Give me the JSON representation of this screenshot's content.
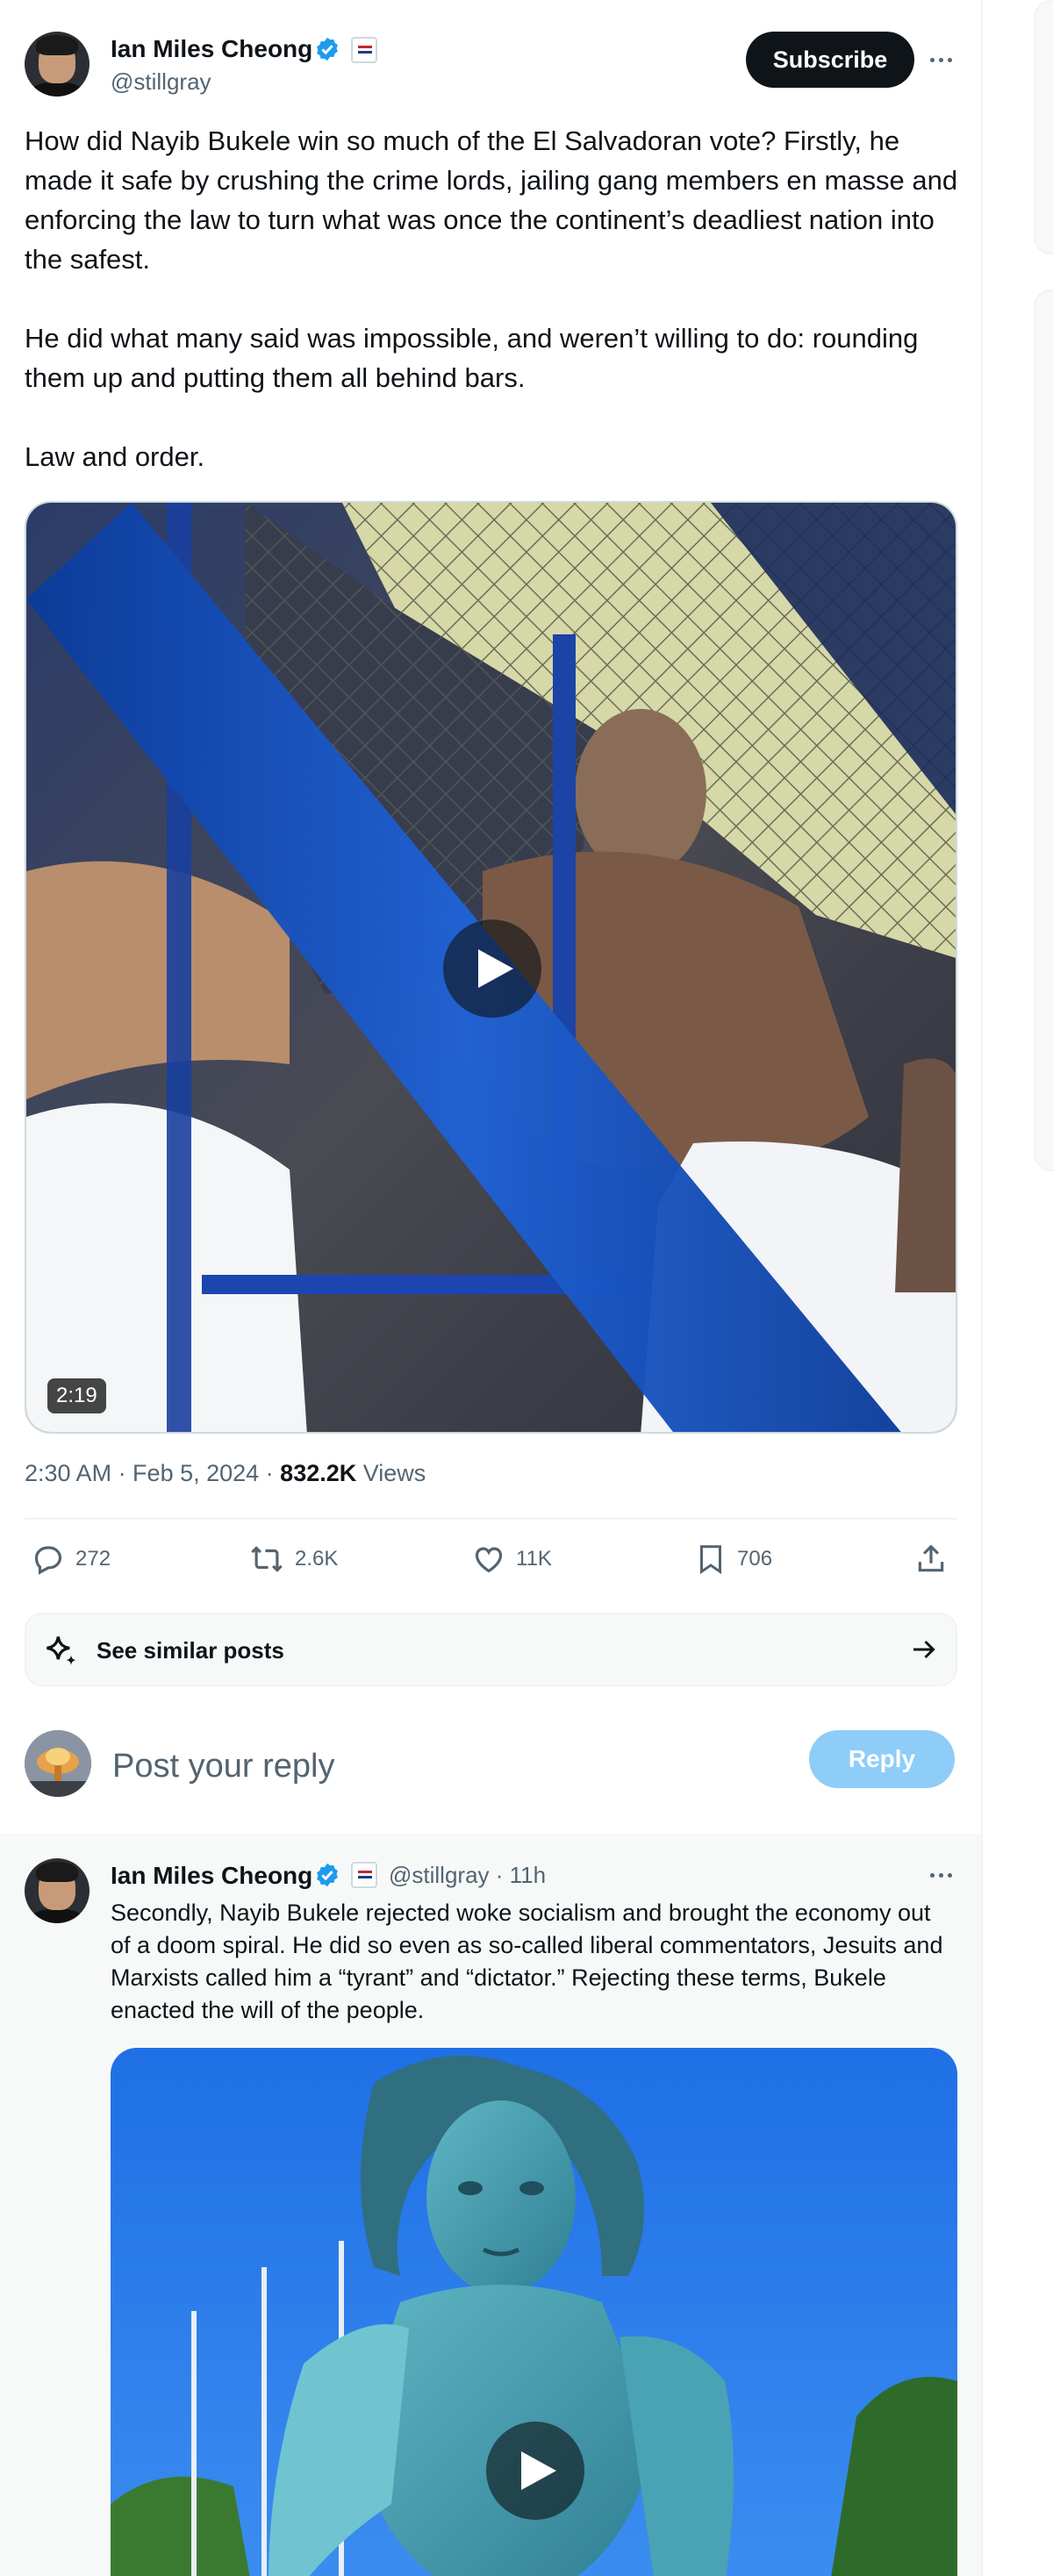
{
  "main_tweet": {
    "author_name": "Ian Miles Cheong",
    "author_handle": "@stillgray",
    "subscribe_label": "Subscribe",
    "paragraphs": [
      "How did Nayib Bukele win so much of the El Salvadoran vote? Firstly, he made it safe by crushing the crime lords, jailing gang members en masse and enforcing the law to turn what was once the continent’s deadliest nation into the safest.",
      "He did what many said was impossible, and weren’t willing to do: rounding them up and putting them all behind bars.",
      "Law and order."
    ],
    "video_duration": "2:19",
    "timestamp": "2:30 AM · Feb 5, 2024 · ",
    "views_count": "832.2K",
    "views_label": " Views",
    "actions": {
      "replies": "272",
      "reposts": "2.6K",
      "likes": "11K",
      "bookmarks": "706"
    },
    "see_similar_label": "See similar posts"
  },
  "reply_composer": {
    "placeholder": "Post your reply",
    "reply_label": "Reply"
  },
  "reply_tweet": {
    "author_name": "Ian Miles Cheong",
    "handle_time": "@stillgray · 11h",
    "text": "Secondly, Nayib Bukele rejected woke socialism and brought the economy out of a doom spiral. He did so even as so-called liberal commentators, Jesuits and Marxists called him a “tyrant” and “dictator.” Rejecting these terms, Bukele enacted the will of the people."
  },
  "colors": {
    "accent_blue": "#1d9bf0",
    "reply_button_disabled": "#8ecdf8",
    "text_primary": "#0f1419",
    "text_secondary": "#536471"
  },
  "icons": [
    "verified-badge-icon",
    "affiliate-flag-icon",
    "more-icon",
    "play-icon",
    "reply-icon",
    "repost-icon",
    "like-icon",
    "bookmark-icon",
    "share-icon",
    "sparkle-icon",
    "arrow-right-icon"
  ]
}
